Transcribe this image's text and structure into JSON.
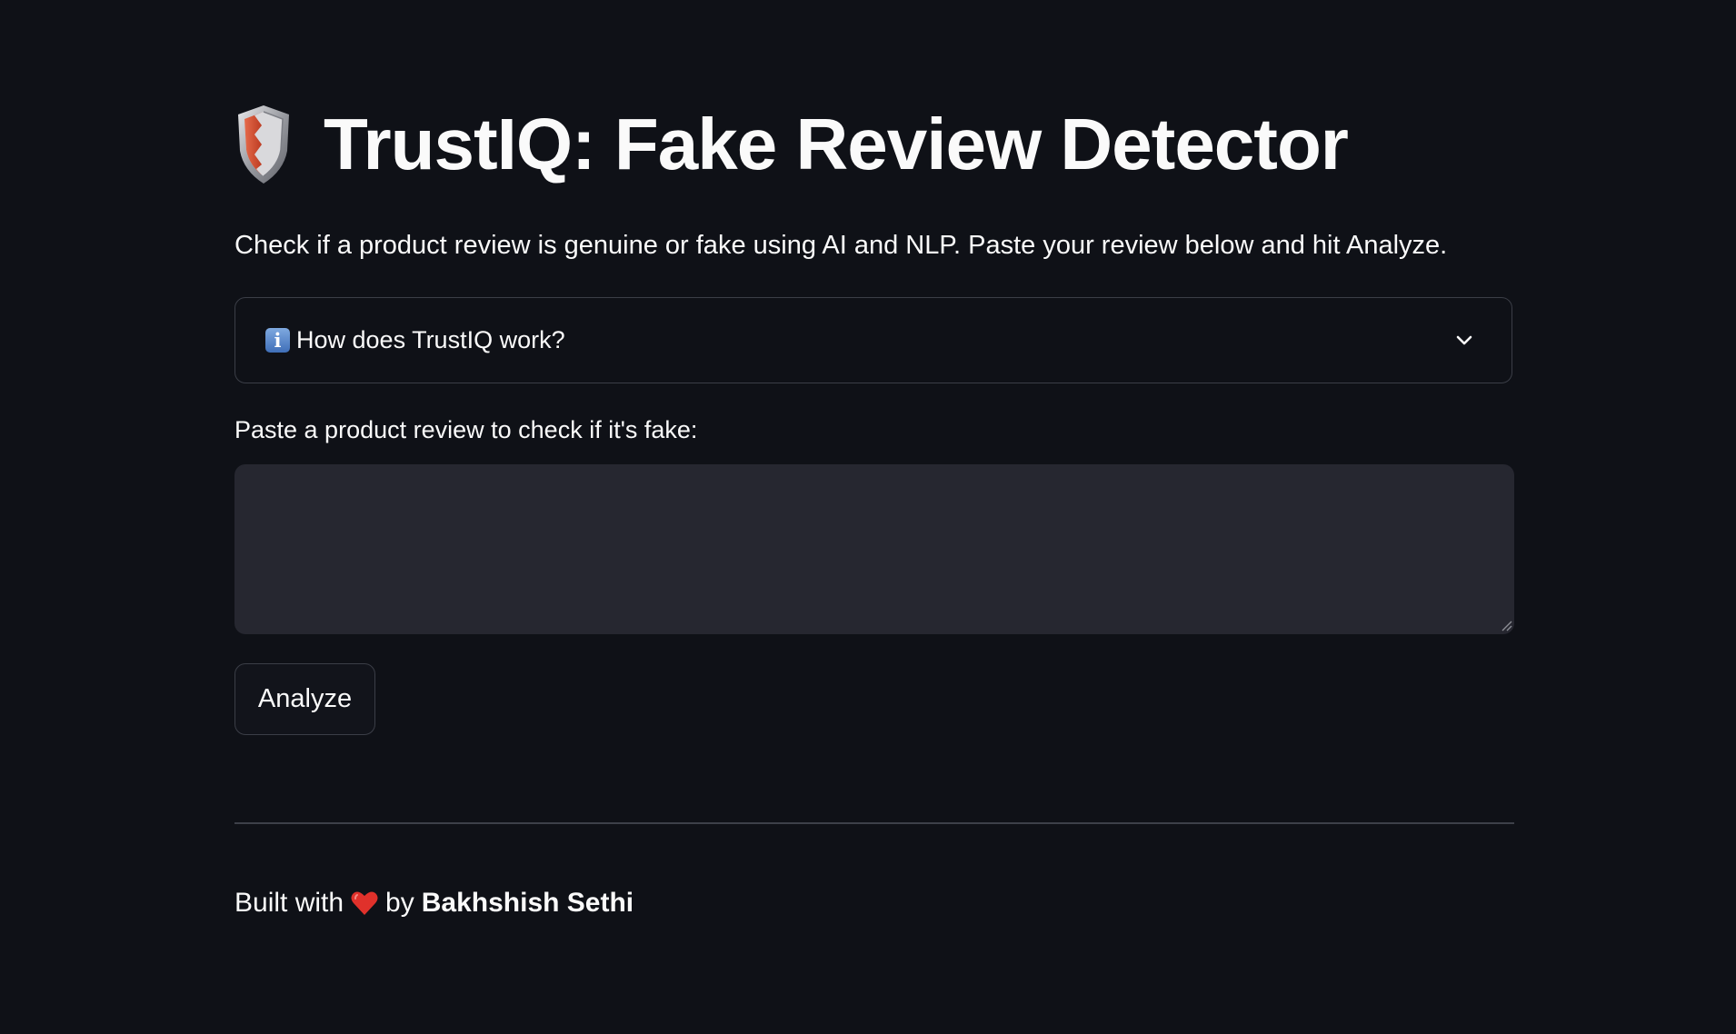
{
  "header": {
    "title": "TrustIQ: Fake Review Detector",
    "icon": "shield-icon",
    "subtitle": "Check if a product review is genuine or fake using AI and NLP. Paste your review below and hit Analyze."
  },
  "expander": {
    "icon": "info-icon",
    "icon_glyph": "i",
    "label": "How does TrustIQ work?",
    "state": "collapsed"
  },
  "review_input": {
    "label": "Paste a product review to check if it's fake:",
    "value": "",
    "placeholder": ""
  },
  "actions": {
    "analyze_label": "Analyze"
  },
  "footer": {
    "prefix": "Built with",
    "icon": "heart-icon",
    "middle": "by",
    "author": "Bakhshish Sethi"
  },
  "colors": {
    "background": "#0f1117",
    "text": "#fafafa",
    "input_background": "#262730",
    "border": "#3b3e47",
    "heart": "#e0312b"
  }
}
